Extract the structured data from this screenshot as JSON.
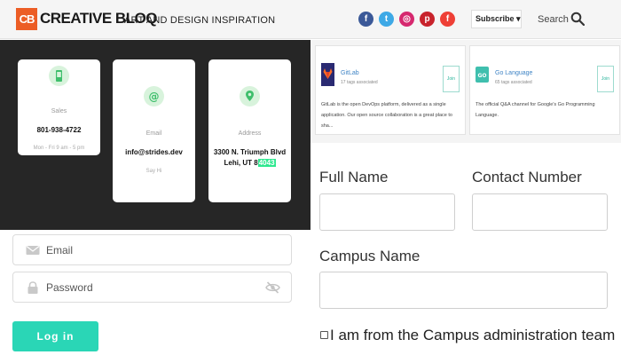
{
  "header": {
    "logo_mark": "CB",
    "logo_text": "CREATIVE BLOQ",
    "tagline": "ART AND DESIGN INSPIRATION",
    "social": {
      "facebook": "f",
      "twitter": "t",
      "instagram": "◎",
      "pinterest": "p",
      "flipboard": "f"
    },
    "subscribe_label": "Subscribe ▾",
    "search_label": "Search"
  },
  "contact_cards": [
    {
      "title": "Sales",
      "value": "801-938-4722",
      "sub": "Mon - Fri 9 am - 5 pm",
      "icon": "phone-icon"
    },
    {
      "title": "Email",
      "value": "info@strides.dev",
      "sub": "Say Hi",
      "icon": "at-icon"
    },
    {
      "title": "Address",
      "value_line1": "3300 N. Triumph Blvd",
      "value_line2_prefix": "Lehi, UT 8",
      "value_line2_highlight": "4043",
      "icon": "map-pin-icon"
    }
  ],
  "login": {
    "email_placeholder": "Email",
    "password_placeholder": "Password",
    "login_label": "Log in"
  },
  "channels": [
    {
      "name": "GitLab",
      "tags": "17 tags associated",
      "join": "Join",
      "description": "GitLab is the open DevOps platform, delivered as a single application. Our open source collaboration is a great place to sha..."
    },
    {
      "name": "Go Language",
      "tags": "65 tags associated",
      "join": "Join",
      "description": "The official Q&A channel for Google's Go Programming Language."
    }
  ],
  "form": {
    "full_name_label": "Full Name",
    "contact_number_label": "Contact Number",
    "campus_name_label": "Campus Name",
    "campus_admin_checkbox_label": "I am from the Campus administration team"
  },
  "colors": {
    "brand_orange": "#ec5d25",
    "accent_teal": "#2ad6b6",
    "dark_panel": "#262626",
    "highlight_green": "#2ee88f"
  }
}
